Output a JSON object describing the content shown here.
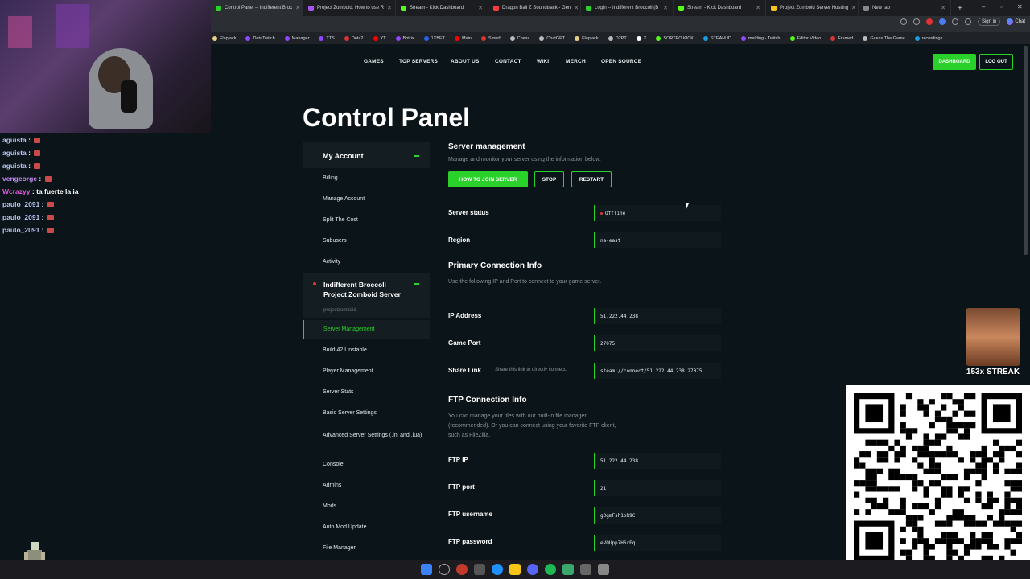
{
  "browser": {
    "tabs": [
      {
        "title": "Control Panel -- Indifferent Broc",
        "color": "#2bd12b"
      },
      {
        "title": "Project Zomboid: How to use R",
        "color": "#a855f7"
      },
      {
        "title": "Stream - Kick Dashboard",
        "color": "#53fc18"
      },
      {
        "title": "Dragon Ball Z Soundtrack - Gen",
        "color": "#ff3b3b"
      },
      {
        "title": "Login -- Indifferent Broccoli (B",
        "color": "#2bd12b"
      },
      {
        "title": "Stream - Kick Dashboard",
        "color": "#53fc18"
      },
      {
        "title": "Project Zomboid Server Hosting",
        "color": "#f5c518"
      },
      {
        "title": "New tab",
        "color": "#888888"
      }
    ],
    "new_tab": "+",
    "signin": "Sign in",
    "chat": "Chat",
    "bookmarks": [
      {
        "label": "Flapjack",
        "color": "#e6d08a"
      },
      {
        "label": "DetaTwitch",
        "color": "#9146ff"
      },
      {
        "label": "Manager",
        "color": "#9146ff"
      },
      {
        "label": "TTS",
        "color": "#9146ff"
      },
      {
        "label": "Dota2",
        "color": "#d33"
      },
      {
        "label": "YT",
        "color": "#ff0000"
      },
      {
        "label": "Botrix",
        "color": "#9146ff"
      },
      {
        "label": "1XBET",
        "color": "#2563eb"
      },
      {
        "label": "Main",
        "color": "#ff0000"
      },
      {
        "label": "Smurf",
        "color": "#d33"
      },
      {
        "label": "Chess",
        "color": "#bbb"
      },
      {
        "label": "ChatGPT",
        "color": "#bbb"
      },
      {
        "label": "Flapjack",
        "color": "#e6d08a"
      },
      {
        "label": "D2PT",
        "color": "#bbb"
      },
      {
        "label": "X",
        "color": "#fff"
      },
      {
        "label": "SORTEO KICK",
        "color": "#53fc18"
      },
      {
        "label": "STEAM ID",
        "color": "#1b9ce0"
      },
      {
        "label": "malding - Twitch",
        "color": "#9146ff"
      },
      {
        "label": "Editor Video",
        "color": "#53fc18"
      },
      {
        "label": "Framed",
        "color": "#d33"
      },
      {
        "label": "Guess The Game",
        "color": "#bbb"
      },
      {
        "label": "recordings",
        "color": "#1b9ce0"
      }
    ]
  },
  "stream_chat": [
    {
      "name": "aguista",
      "msg": ""
    },
    {
      "name": "aguista",
      "msg": ""
    },
    {
      "name": "aguista",
      "msg": ""
    },
    {
      "name": "vengeorge",
      "msg": ""
    },
    {
      "name": "Wcrazyy",
      "msg": "ta fuerte la ia"
    },
    {
      "name": "paulo_2091",
      "msg": ""
    },
    {
      "name": "paulo_2091",
      "msg": ""
    },
    {
      "name": "paulo_2091",
      "msg": ""
    }
  ],
  "nav": {
    "links": [
      "GAMES",
      "TOP SERVERS",
      "ABOUT US",
      "CONTACT",
      "WIKI",
      "MERCH",
      "OPEN SOURCE"
    ],
    "dashboard": "DASHBOARD",
    "logout": "LOG OUT"
  },
  "page_title": "Control Panel",
  "sidebar": {
    "account_title": "My Account",
    "account_items": [
      "Billing",
      "Manage Account",
      "Split The Cost",
      "Subusers",
      "Activity"
    ],
    "server_title": "Indifferent Broccoli Project Zomboid Server",
    "server_sub": "projectzomboid",
    "server_items": [
      "Server Management",
      "Build 42 Unstable",
      "Player Management",
      "Server Stats",
      "Basic Server Settings",
      "Advanced Server Settings (.ini and .lua)",
      "Console",
      "Admins",
      "Mods",
      "Auto Mod Update",
      "File Manager"
    ],
    "active_item": "Server Management"
  },
  "main": {
    "section_title": "Server management",
    "section_desc": "Manage and monitor your server using the information below.",
    "buttons": {
      "join": "HOW TO JOIN SERVER",
      "stop": "STOP",
      "restart": "RESTART"
    },
    "status_label": "Server status",
    "status_value": "Offline",
    "region_label": "Region",
    "region_value": "na-east",
    "primary_title": "Primary Connection Info",
    "primary_desc": "Use the following IP and Port to connect to your game server.",
    "ip_label": "IP Address",
    "ip_value": "51.222.44.238",
    "port_label": "Game Port",
    "port_value": "27075",
    "share_label": "Share Link",
    "share_hint": "Share this link to directly connect.",
    "share_value": "steam://connect/51.222.44.238:27075",
    "ftp_title": "FTP Connection Info",
    "ftp_desc": "You can manage your files with our built-in file manager (recommended). Or you can connect using your favorite FTP client, such as FileZilla.",
    "ftp_ip_label": "FTP IP",
    "ftp_ip_value": "51.222.44.238",
    "ftp_port_label": "FTP port",
    "ftp_port_value": "21",
    "ftp_user_label": "FTP username",
    "ftp_user_value": "g3gmFsh1oR9C",
    "ftp_pass_label": "FTP password",
    "ftp_pass_value": "eVQUpp7H6rEq"
  },
  "overlay": {
    "streak": "153x STREAK"
  },
  "colors": {
    "accent": "#2bd12b",
    "bg": "#0b1418",
    "panel": "#131d22",
    "offline": "#e53935"
  }
}
